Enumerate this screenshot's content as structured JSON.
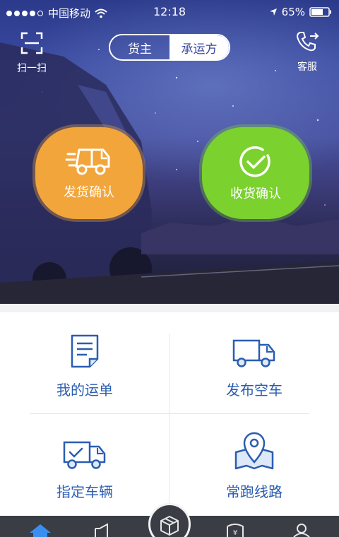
{
  "status_bar": {
    "carrier": "中国移动",
    "time": "12:18",
    "battery": "65%"
  },
  "header": {
    "scan_label": "扫一扫",
    "service_label": "客服",
    "segment": {
      "left": "货主",
      "right": "承运方",
      "selected": "承运方"
    }
  },
  "actions": {
    "ship_confirm": "发货确认",
    "receive_confirm": "收货确认"
  },
  "menu": {
    "my_waybill": "我的运单",
    "publish_empty_truck": "发布空车",
    "assign_vehicle": "指定车辆",
    "regular_route": "常跑线路"
  },
  "tabbar": {
    "items": [
      "home-icon",
      "megaphone-icon",
      "package-icon",
      "finance-shield-icon",
      "profile-icon"
    ],
    "active": "home-icon"
  },
  "colors": {
    "ship_button": "#f2a53a",
    "receive_button": "#7bd12e",
    "menu_text": "#2a5db0",
    "tabbar_bg": "#3a3d44"
  }
}
